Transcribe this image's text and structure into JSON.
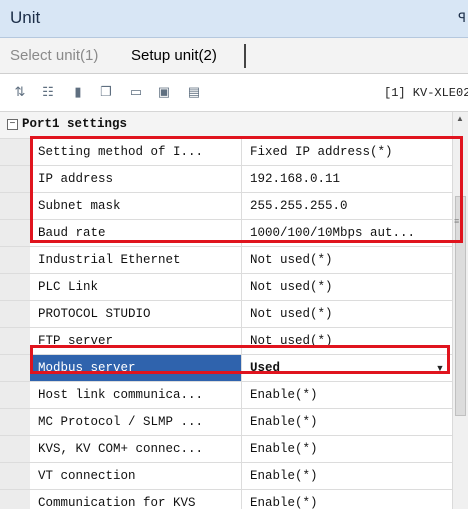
{
  "window": {
    "title": "Unit",
    "pin_glyph": "ꟼ"
  },
  "tabs": [
    {
      "label": "Select unit(1)",
      "active": false
    },
    {
      "label": "Setup unit(2)",
      "active": true
    }
  ],
  "toolbar": {
    "icons": [
      "sort-icon",
      "filter-icon",
      "unit-icon",
      "copy-icon",
      "view-icon",
      "monitor-icon",
      "export-icon"
    ],
    "unit_name": "[1] KV-XLE02"
  },
  "group": {
    "expander": "−",
    "label": "Port1 settings"
  },
  "rows": [
    {
      "name": "Setting method of I...",
      "value": "Fixed IP address(*)"
    },
    {
      "name": "IP address",
      "value": "192.168.0.11"
    },
    {
      "name": "Subnet mask",
      "value": "255.255.255.0"
    },
    {
      "name": "Baud rate",
      "value": "1000/100/10Mbps aut..."
    },
    {
      "name": "Industrial Ethernet",
      "value": "Not used(*)"
    },
    {
      "name": "PLC Link",
      "value": "Not used(*)"
    },
    {
      "name": "PROTOCOL STUDIO",
      "value": "Not used(*)"
    },
    {
      "name": "FTP server",
      "value": "Not used(*)"
    },
    {
      "name": "Modbus server",
      "value": "Used"
    },
    {
      "name": "Host link communica...",
      "value": "Enable(*)"
    },
    {
      "name": "MC Protocol / SLMP ...",
      "value": "Enable(*)"
    },
    {
      "name": "KVS, KV COM+ connec...",
      "value": "Enable(*)"
    },
    {
      "name": "VT connection",
      "value": "Enable(*)"
    },
    {
      "name": "Communication for KVS",
      "value": "Enable(*)"
    }
  ],
  "selected_row_index": 8,
  "colors": {
    "selection": "#2f63ad",
    "highlight": "#e0141e",
    "title_bar": "#d8e6f5"
  }
}
